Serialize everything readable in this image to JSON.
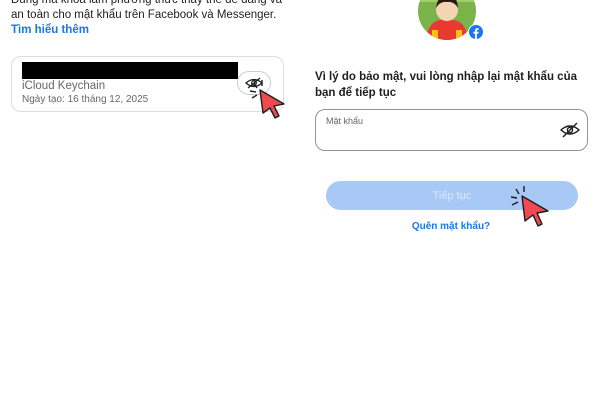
{
  "left": {
    "intro": {
      "text": "Dùng mã khóa làm phương thức thay thế dễ dàng và an toàn cho mật khẩu trên Facebook và Messenger.",
      "link": "Tìm hiểu thêm"
    },
    "passkey": {
      "name": "iCloud Keychain",
      "created": "Ngày tạo: 16 tháng 12, 2025",
      "button_icon": "eye-off-icon"
    }
  },
  "right": {
    "avatar_icon": "profile-avatar",
    "badge_icon": "facebook-icon",
    "prompt": "Vì lý do bảo mật, vui lòng nhập lại mật khẩu của bạn để tiếp tục",
    "password": {
      "label": "Mật khẩu",
      "value": "",
      "toggle_icon": "eye-off-icon"
    },
    "continue_label": "Tiếp tục",
    "forgot_label": "Quên mật khẩu?"
  },
  "colors": {
    "accent": "#1877f2",
    "button_disabled": "#a8c9f5",
    "cursor": "#f0494f"
  }
}
